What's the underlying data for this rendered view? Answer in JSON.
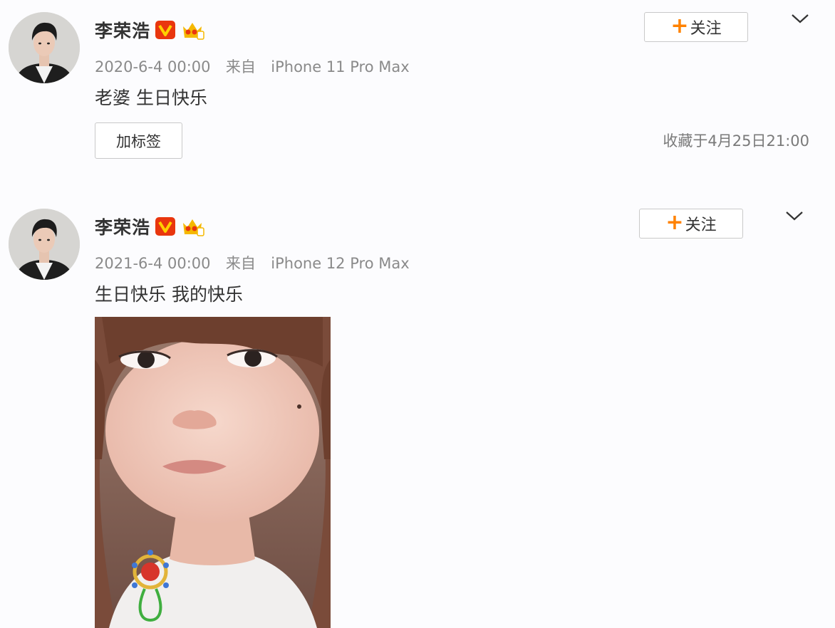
{
  "posts": [
    {
      "username": "李荣浩",
      "follow_label": "关注",
      "date": "2020-6-4 00:00",
      "source_prefix": "来自",
      "device": "iPhone 11 Pro Max",
      "text": "老婆 生日快乐",
      "tag_button": "加标签",
      "favorited_time": "收藏于4月25日21:00"
    },
    {
      "username": "李荣浩",
      "follow_label": "关注",
      "date": "2021-6-4 00:00",
      "source_prefix": "来自",
      "device": "iPhone 12 Pro Max",
      "text": "生日快乐 我的快乐"
    }
  ],
  "icons": {
    "verified_badge": "verified-v-icon",
    "vip_badge": "vip-crown-icon",
    "follow_plus": "plus-icon",
    "more_menu": "chevron-down-icon"
  },
  "colors": {
    "accent_orange": "#ff8200",
    "verified_red": "#e9360e",
    "vip_yellow": "#f5b800",
    "meta_gray": "#8a8a8a",
    "text_dark": "#333333"
  }
}
